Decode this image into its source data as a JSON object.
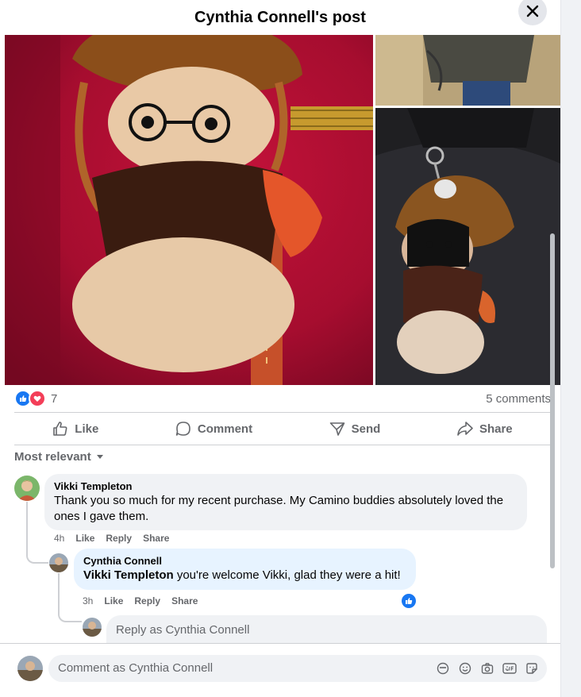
{
  "header": {
    "title": "Cynthia Connell's post"
  },
  "reactions": {
    "count": "7",
    "comments": "5 comments"
  },
  "actions": {
    "like": "Like",
    "comment": "Comment",
    "send": "Send",
    "share": "Share"
  },
  "sort": {
    "label": "Most relevant"
  },
  "comments": [
    {
      "author": "Vikki Templeton",
      "text": "Thank you so much for my recent purchase. My Camino buddies absolutely loved the ones I gave them.",
      "time": "4h",
      "like": "Like",
      "reply": "Reply",
      "share": "Share"
    }
  ],
  "reply": {
    "author": "Cynthia Connell",
    "mention": "Vikki Templeton",
    "text": " you're welcome Vikki, glad they were a hit!",
    "time": "3h",
    "like": "Like",
    "reply": "Reply",
    "share": "Share"
  },
  "reply_input": {
    "placeholder": "Reply as Cynthia Connell"
  },
  "comment_input": {
    "placeholder": "Comment as Cynthia Connell"
  },
  "icons": [
    "close-icon",
    "like-reaction-icon",
    "love-reaction-icon",
    "thumbs-up-icon",
    "comment-icon",
    "send-icon",
    "share-icon",
    "chevron-down-icon",
    "avatar-icon",
    "emoji-icon",
    "camera-icon",
    "gif-icon",
    "sticker-icon",
    "avatar-sticker-icon"
  ],
  "colors": {
    "accent": "#1877f2",
    "love": "#f33e58",
    "secondary_text": "#65676b",
    "bubble": "#f0f2f5",
    "highlight_bubble": "#e7f3ff"
  }
}
